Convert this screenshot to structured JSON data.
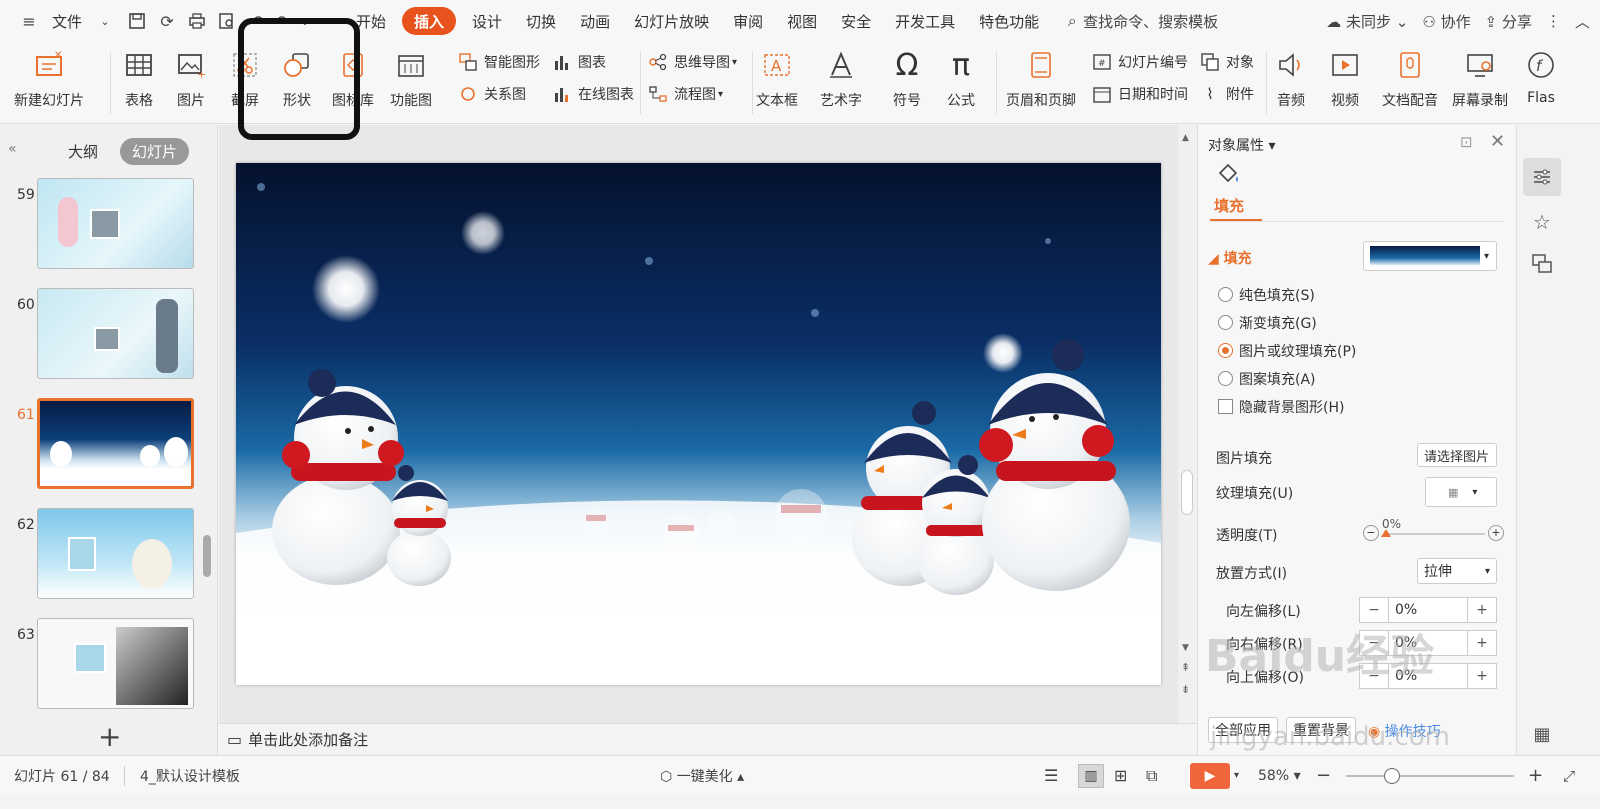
{
  "menubar": {
    "file_label": "文件",
    "items": [
      "开始",
      "插入",
      "设计",
      "切换",
      "动画",
      "幻灯片放映",
      "审阅",
      "视图",
      "安全",
      "开发工具",
      "特色功能"
    ],
    "active_item": "插入",
    "search_label": "查找命令、搜索模板",
    "sync_label": "未同步",
    "collab_label": "协作",
    "share_label": "分享"
  },
  "ribbon": {
    "new_slide": "新建幻灯片",
    "table": "表格",
    "picture": "图片",
    "screenshot": "截屏",
    "shape": "形状",
    "gallery": "图标库",
    "function_chart": "功能图",
    "smart_art": "智能图形",
    "chart": "图表",
    "relation": "关系图",
    "online_chart": "在线图表",
    "mindmap": "思维导图",
    "flowchart": "流程图",
    "textbox": "文本框",
    "wordart": "艺术字",
    "symbol": "符号",
    "formula": "公式",
    "header_footer": "页眉和页脚",
    "slide_number": "幻灯片编号",
    "object": "对象",
    "date_time": "日期和时间",
    "attachment": "附件",
    "audio": "音频",
    "video": "视频",
    "doc_dub": "文档配音",
    "screen_record": "屏幕录制",
    "flash": "Flas"
  },
  "leftpanel": {
    "tab_outline": "大纲",
    "tab_slides": "幻灯片",
    "thumbs": [
      {
        "num": "59"
      },
      {
        "num": "60"
      },
      {
        "num": "61"
      },
      {
        "num": "62"
      },
      {
        "num": "63"
      }
    ]
  },
  "notes": {
    "placeholder": "单击此处添加备注"
  },
  "props": {
    "title": "对象属性",
    "tab_fill": "填充",
    "section_fill": "填充",
    "options": [
      {
        "label": "纯色填充(S)",
        "checked": false
      },
      {
        "label": "渐变填充(G)",
        "checked": false
      },
      {
        "label": "图片或纹理填充(P)",
        "checked": true
      },
      {
        "label": "图案填充(A)",
        "checked": false
      }
    ],
    "hide_bg": "隐藏背景图形(H)",
    "picture_fill": "图片填充",
    "picture_fill_btn": "请选择图片",
    "texture_fill": "纹理填充(U)",
    "transparency": "透明度(T)",
    "transparency_val": "0%",
    "placement": "放置方式(I)",
    "placement_val": "拉伸",
    "offset_left": "向左偏移(L)",
    "offset_left_val": "0%",
    "offset_right": "向右偏移(R)",
    "offset_right_val": "0%",
    "offset_up": "向上偏移(O)",
    "offset_up_val": "0%",
    "apply_all": "全部应用",
    "reset_bg": "重置背景",
    "tips": "操作技巧"
  },
  "status": {
    "slide_info": "幻灯片 61 / 84",
    "template": "4_默认设计模板",
    "beautify": "一键美化",
    "zoom": "58%"
  },
  "watermark": {
    "text": "Baidu经验",
    "url": "jingyan.baidu.com"
  },
  "colors": {
    "accent": "#e8722d",
    "active_tab": "#e8521d"
  }
}
